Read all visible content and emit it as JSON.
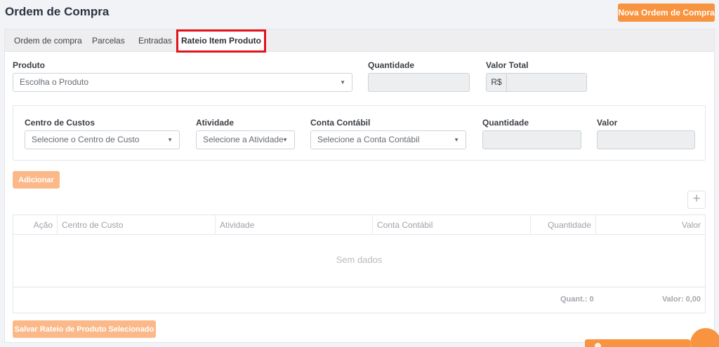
{
  "header": {
    "title": "Ordem de Compra",
    "new_button": "Nova Ordem de Compra"
  },
  "tabs": [
    {
      "label": "Ordem de compra"
    },
    {
      "label": "Parcelas"
    },
    {
      "label": "Entradas"
    },
    {
      "label": "Rateio Item Produto",
      "active": true
    }
  ],
  "product_section": {
    "produto_label": "Produto",
    "produto_placeholder": "Escolha o Produto",
    "quantidade_label": "Quantidade",
    "valor_total_label": "Valor Total",
    "currency_prefix": "R$"
  },
  "allocation_form": {
    "centro_label": "Centro de Custos",
    "centro_placeholder": "Selecione o Centro de Custo",
    "atividade_label": "Atividade",
    "atividade_placeholder": "Selecione a Atividade",
    "conta_label": "Conta Contábil",
    "conta_placeholder": "Selecione a Conta Contábil",
    "quantidade_label": "Quantidade",
    "valor_label": "Valor"
  },
  "actions": {
    "add_button": "Adicionar",
    "plus": "+",
    "save_button": "Salvar Rateio de Produto Selecionado"
  },
  "grid": {
    "columns": [
      "Ação",
      "Centro de Custo",
      "Atividade",
      "Conta Contábil",
      "Quantidade",
      "Valor"
    ],
    "empty_text": "Sem dados",
    "footer_quant": "Quant.: 0",
    "footer_valor": "Valor: 0,00"
  },
  "colors": {
    "accent": "#f8943f",
    "accent_light": "#fbb98a",
    "tab_highlight": "#e2131a"
  },
  "icons": {
    "caret": "chevron-down-icon",
    "chat": "chat-icon"
  }
}
